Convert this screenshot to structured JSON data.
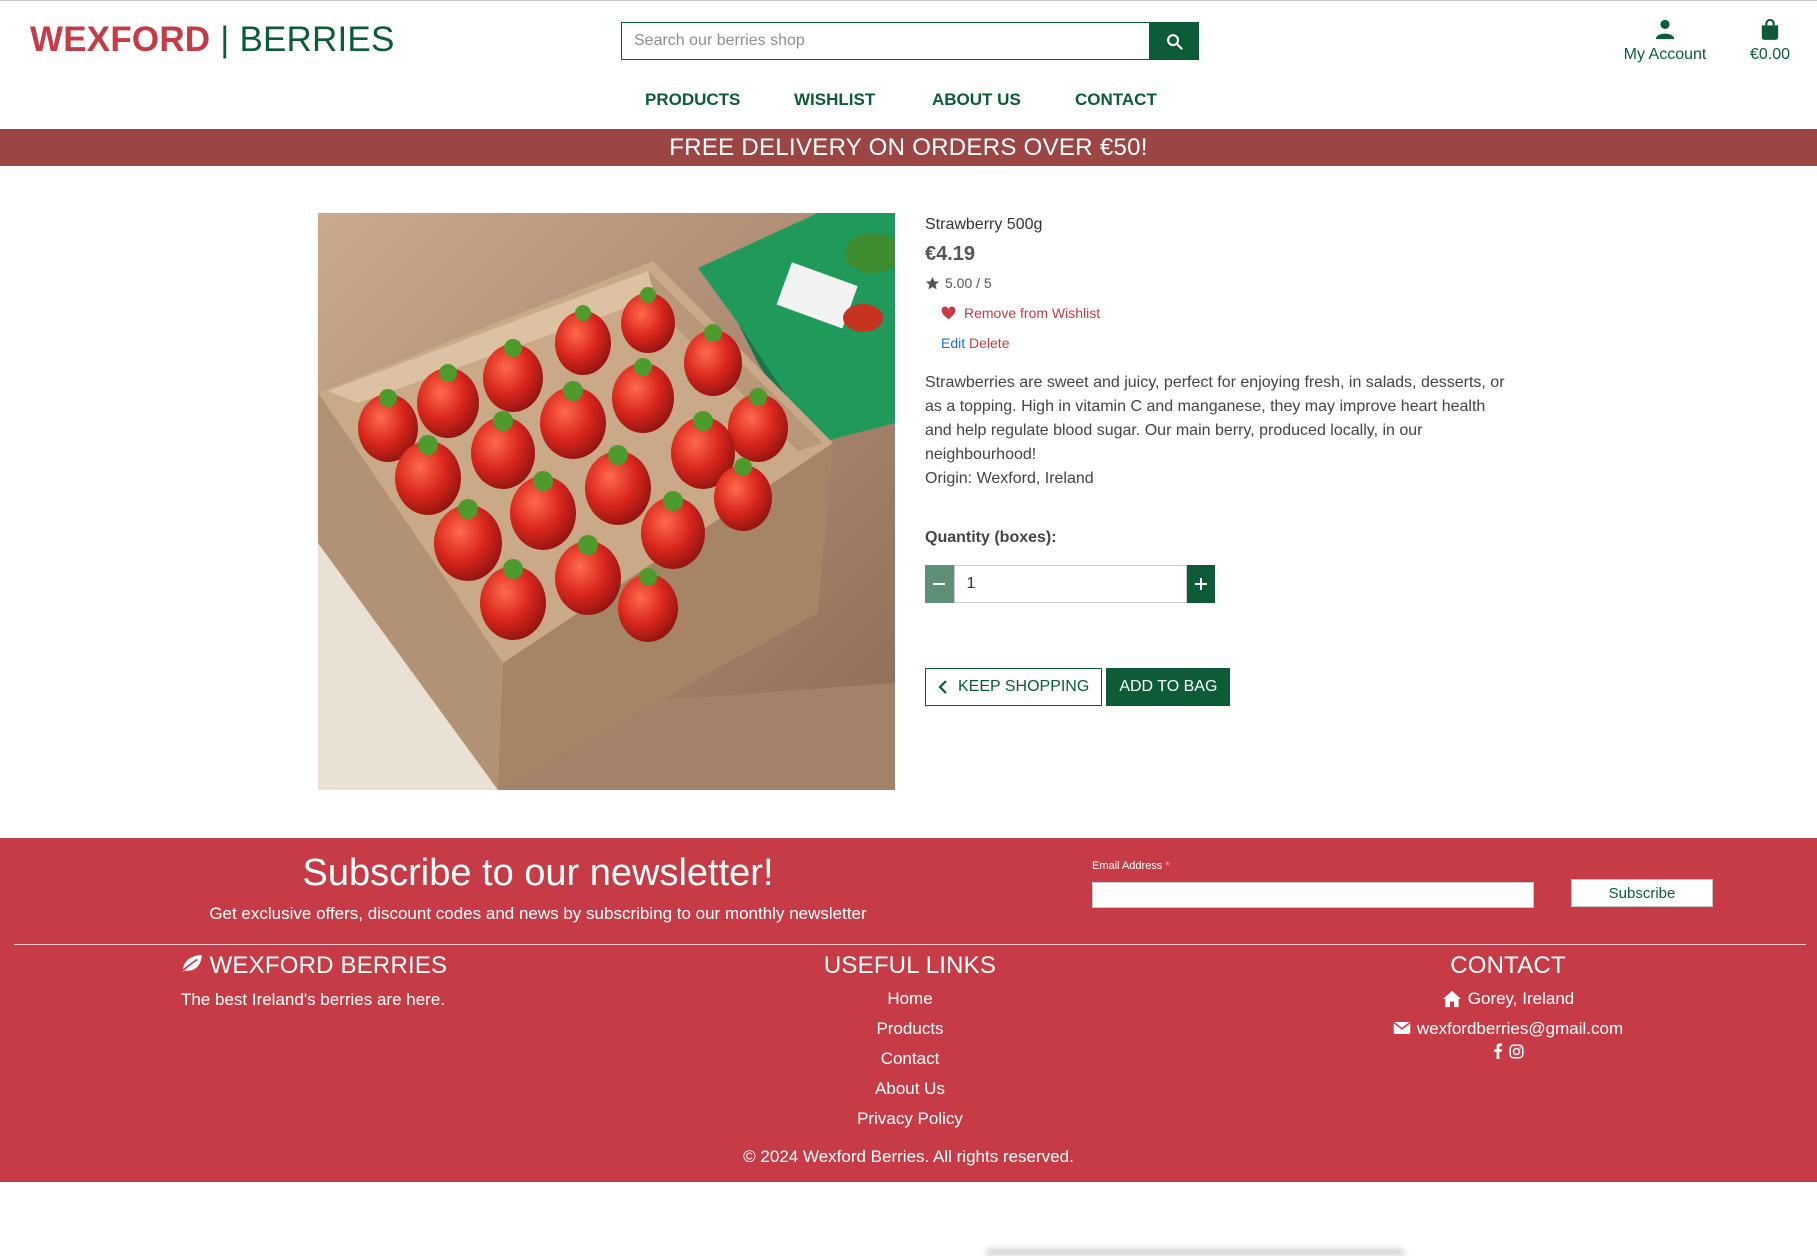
{
  "header": {
    "logo_part1": "WEXFORD",
    "logo_sep": "|",
    "logo_part2": "BERRIES",
    "search_placeholder": "Search our berries shop",
    "account_label": "My Account",
    "bag_total": "€0.00"
  },
  "nav": [
    {
      "label": "PRODUCTS"
    },
    {
      "label": "WISHLIST"
    },
    {
      "label": "ABOUT US"
    },
    {
      "label": "CONTACT"
    }
  ],
  "promo": "FREE DELIVERY ON ORDERS OVER €50!",
  "product": {
    "name": "Strawberry 500g",
    "price": "€4.19",
    "rating": "5.00 / 5",
    "wishlist_label": "Remove from Wishlist",
    "edit_label": "Edit",
    "delete_label": "Delete",
    "description": "Strawberries are sweet and juicy, perfect for enjoying fresh, in salads, desserts, or as a topping. High in vitamin C and manganese, they may improve heart health and help regulate blood sugar. Our main berry, produced locally, in our neighbourhood!",
    "origin": "Origin: Wexford, Ireland",
    "quantity_label": "Quantity (boxes):",
    "quantity_value": "1",
    "keep_shopping_label": "KEEP SHOPPING",
    "add_to_bag_label": "ADD TO BAG"
  },
  "footer": {
    "newsletter_title": "Subscribe to our newsletter!",
    "newsletter_subtitle": "Get exclusive offers, discount codes and news by subscribing to our monthly newsletter",
    "email_label": "Email Address",
    "email_required_mark": "*",
    "subscribe_label": "Subscribe",
    "brand_title": "WEXFORD BERRIES",
    "brand_tagline": "The best Ireland's berries are here.",
    "links_title": "USEFUL LINKS",
    "links": [
      {
        "label": "Home"
      },
      {
        "label": "Products"
      },
      {
        "label": "Contact"
      },
      {
        "label": "About Us"
      },
      {
        "label": "Privacy Policy"
      }
    ],
    "contact_title": "CONTACT",
    "contact_location": "Gorey, Ireland",
    "contact_email": "wexfordberries@gmail.com",
    "copyright": "© 2024 Wexford Berries. All rights reserved."
  },
  "colors": {
    "brand_red": "#c73b47",
    "brand_green": "#0d5c37",
    "promo_bg": "#9c4545",
    "link_blue": "#1e6fd9"
  },
  "icons": [
    "search-icon",
    "user-icon",
    "shopping-bag-icon",
    "star-icon",
    "heart-icon",
    "minus-icon",
    "plus-icon",
    "chevron-left-icon",
    "leaf-icon",
    "home-icon",
    "envelope-icon",
    "facebook-icon",
    "instagram-icon"
  ]
}
